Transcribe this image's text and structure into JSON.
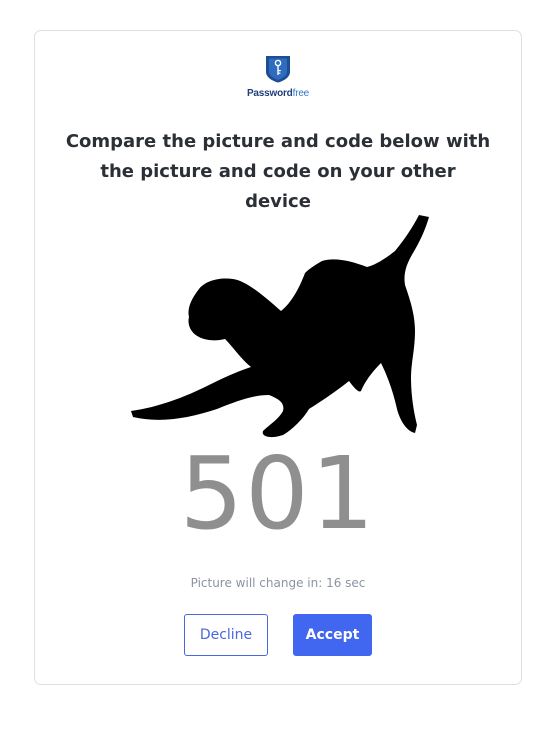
{
  "logo": {
    "text_main": "Password",
    "text_accent": "free",
    "icon": "key-shield-icon"
  },
  "heading": "Compare the picture and code below with the picture and code on your other device",
  "picture": {
    "icon": "dog-silhouette-icon"
  },
  "code": "501",
  "timer": {
    "text": "Picture will change in: 16 sec"
  },
  "buttons": {
    "decline_label": "Decline",
    "accept_label": "Accept"
  },
  "colors": {
    "accent": "#4166f0",
    "code_text": "#8f8f8f",
    "brand_blue": "#1f3f7a"
  }
}
